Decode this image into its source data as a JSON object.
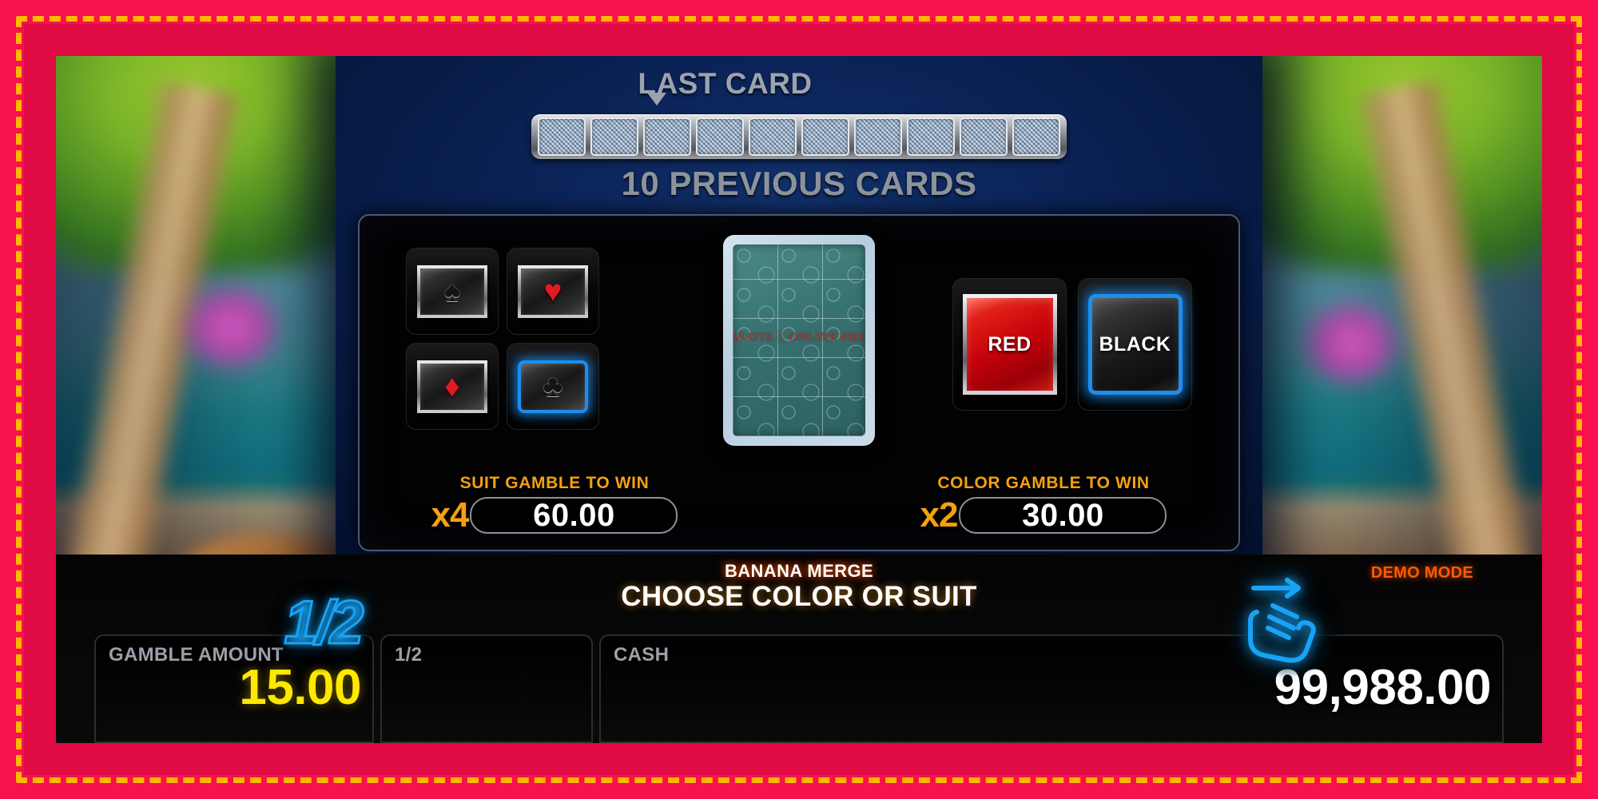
{
  "header": {
    "last_card_label": "LAST CARD",
    "previous_cards_label": "10 PREVIOUS CARDS",
    "previous_cards_count": 10
  },
  "suit_buttons": [
    {
      "name": "spade",
      "glyph": "♠",
      "selected": false
    },
    {
      "name": "heart",
      "glyph": "♥",
      "selected": false
    },
    {
      "name": "diamond",
      "glyph": "♦",
      "selected": false
    },
    {
      "name": "club",
      "glyph": "♣",
      "selected": true
    }
  ],
  "card": {
    "face_down": true,
    "watermark": "SLOTS ░ ONLINE FREE"
  },
  "color_buttons": [
    {
      "name": "red",
      "label": "RED",
      "selected": false,
      "color": "#c4000a"
    },
    {
      "name": "black",
      "label": "BLACK",
      "selected": true,
      "color": "#191919"
    }
  ],
  "suit_gamble": {
    "title": "SUIT GAMBLE TO WIN",
    "multiplier": "x4",
    "value": "60.00"
  },
  "color_gamble": {
    "title": "COLOR GAMBLE TO WIN",
    "multiplier": "x2",
    "value": "30.00"
  },
  "hud": {
    "game_name": "BANANA MERGE",
    "status_message": "CHOOSE COLOR OR SUIT",
    "demo_mode": "DEMO MODE",
    "meters": [
      {
        "label": "GAMBLE AMOUNT",
        "value": "15.00"
      },
      {
        "label": "1/2",
        "value": ""
      },
      {
        "label": "CASH",
        "value": "99,988.00"
      }
    ]
  },
  "controls": {
    "half_label": "1/2",
    "swipe_icon": "swipe-hand-icon"
  },
  "colors": {
    "frame_pink": "#f9104e",
    "frame_dash_yellow": "#ffb700",
    "accent_orange": "#f5a011",
    "accent_blue": "#18a3f5",
    "gamble_yellow": "#ffe800",
    "demo_orange": "#ff5a00"
  }
}
